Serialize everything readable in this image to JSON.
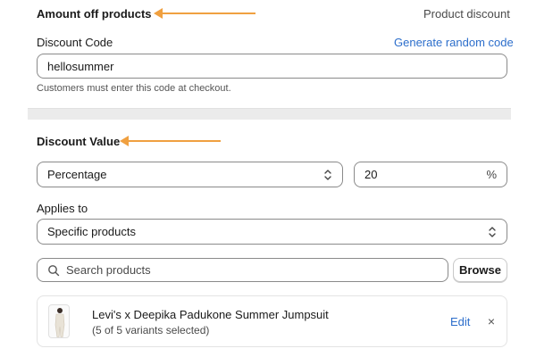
{
  "amount_section": {
    "title": "Amount off products",
    "type_label": "Product discount"
  },
  "discount_code": {
    "label": "Discount Code",
    "generate_link": "Generate random code",
    "value": "hellosummer",
    "help_text": "Customers must enter this code at checkout."
  },
  "discount_value": {
    "title": "Discount Value",
    "type_select": "Percentage",
    "amount": "20",
    "amount_suffix": "%"
  },
  "applies_to": {
    "label": "Applies to",
    "select_value": "Specific products"
  },
  "search": {
    "placeholder": "Search products",
    "browse_label": "Browse"
  },
  "selected_product": {
    "name": "Levi's x Deepika Padukone Summer Jumpsuit",
    "variants": "(5 of 5 variants selected)",
    "edit_label": "Edit",
    "remove_symbol": "×"
  },
  "annotation_color": "#f0a040",
  "icons": [
    "selector-icon",
    "search-icon",
    "close-icon",
    "arrow-annotation-icon"
  ]
}
